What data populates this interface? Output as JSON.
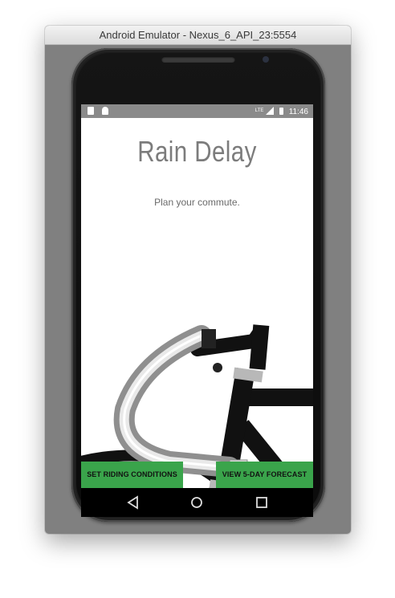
{
  "window": {
    "title": "Android Emulator - Nexus_6_API_23:5554"
  },
  "statusbar": {
    "network": "LTE",
    "time": "11:46"
  },
  "app": {
    "title": "Rain Delay",
    "subtitle": "Plan your commute."
  },
  "buttons": {
    "set_riding_conditions": "SET RIDING CONDITIONS",
    "view_forecast": "VIEW 5-DAY FORECAST"
  },
  "navbar": {
    "icons": [
      "back-triangle-icon",
      "home-circle-icon",
      "recents-square-icon"
    ]
  },
  "colors": {
    "button": "#3aa44b",
    "title": "#7c7c7c",
    "statusbar": "#8a8a8a",
    "emulator_bg": "#808080"
  }
}
